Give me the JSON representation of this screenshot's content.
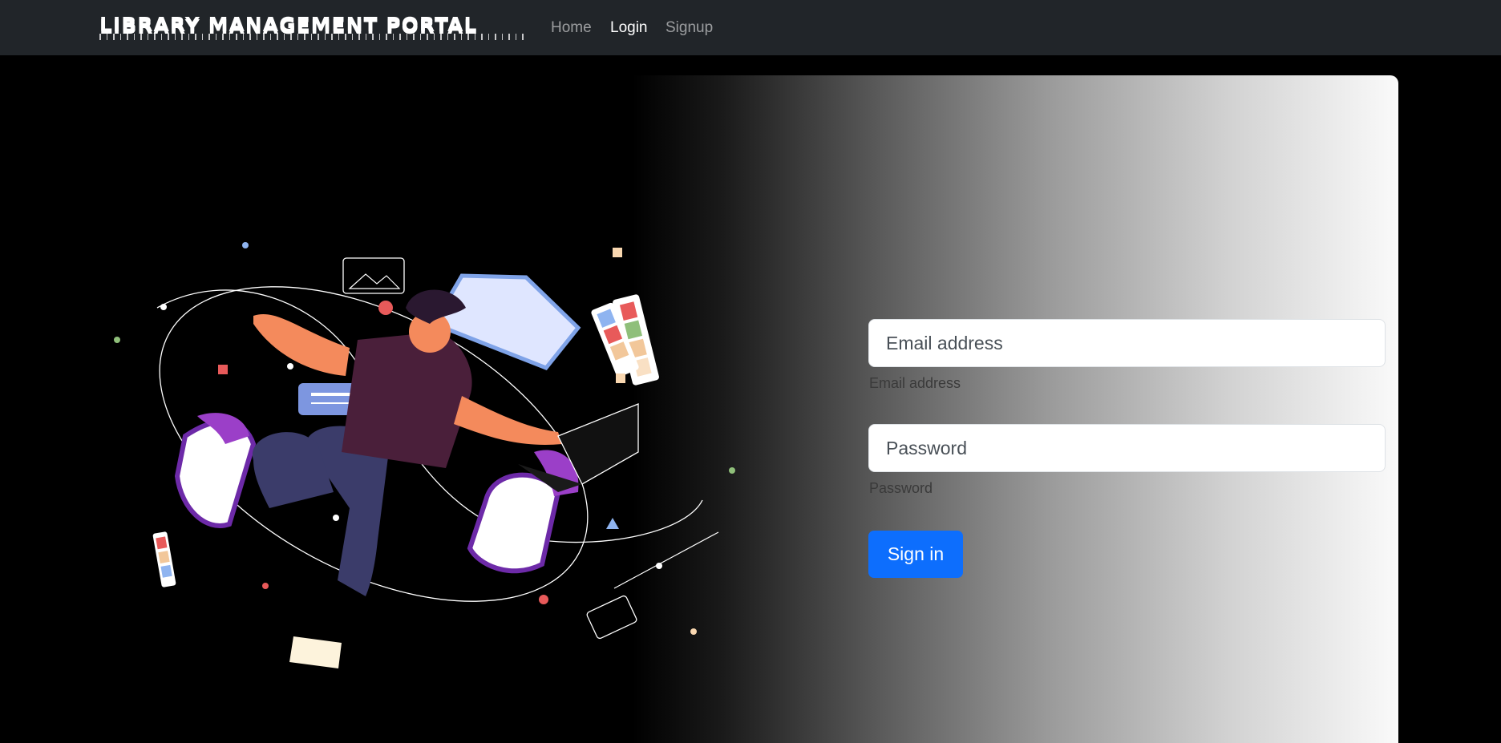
{
  "navbar": {
    "brand": "LIBRARY MANAGEMENT PORTAL",
    "links": [
      {
        "label": "Home",
        "active": false
      },
      {
        "label": "Login",
        "active": true
      },
      {
        "label": "Signup",
        "active": false
      }
    ]
  },
  "login_form": {
    "email": {
      "placeholder": "Email address",
      "label": "Email address",
      "value": ""
    },
    "password": {
      "placeholder": "Password",
      "label": "Password",
      "value": ""
    },
    "submit_label": "Sign in"
  },
  "colors": {
    "navbar_bg": "#212529",
    "primary_button": "#0d6efd",
    "card_gradient_start": "#000000",
    "card_gradient_end": "#fafafa"
  },
  "illustration": {
    "icon": "person-working-with-laptop-illustration"
  }
}
